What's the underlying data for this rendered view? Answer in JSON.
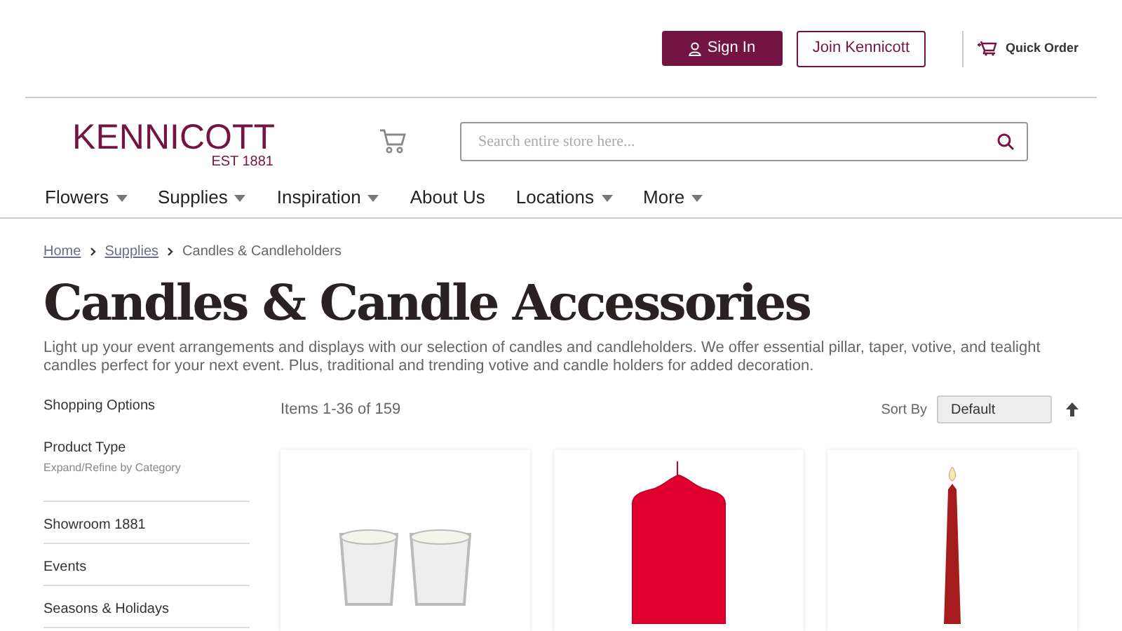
{
  "header": {
    "sign_in": "Sign In",
    "join": "Join Kennicott",
    "quick_order": "Quick Order"
  },
  "logo": {
    "name": "KENNICOTT",
    "tagline": "EST 1881"
  },
  "search": {
    "placeholder": "Search entire store here..."
  },
  "nav": [
    {
      "label": "Flowers",
      "dropdown": true
    },
    {
      "label": "Supplies",
      "dropdown": true
    },
    {
      "label": "Inspiration",
      "dropdown": true
    },
    {
      "label": "About Us",
      "dropdown": false
    },
    {
      "label": "Locations",
      "dropdown": true
    },
    {
      "label": "More",
      "dropdown": true
    }
  ],
  "breadcrumbs": [
    {
      "label": "Home",
      "link": true
    },
    {
      "label": "Supplies",
      "link": true
    },
    {
      "label": "Candles & Candleholders",
      "link": false
    }
  ],
  "title": "Candles & Candle Accessories",
  "description": "Light up your event arrangements and displays with our selection of candles and candleholders. We offer essential pillar, taper, votive, and tealight candles perfect for your next event. Plus, traditional and trending votive and candle holders for added decoration.",
  "sidebar": {
    "heading": "Shopping Options",
    "filter": {
      "title": "Product Type",
      "hint": "Expand/Refine by Category"
    },
    "items": [
      "Showroom 1881",
      "Events",
      "Seasons & Holidays"
    ]
  },
  "toolbar": {
    "count": "Items 1-36 of 159",
    "sort_label": "Sort By",
    "sort_value": "Default"
  },
  "products": [
    {
      "kind": "votive"
    },
    {
      "kind": "pillar"
    },
    {
      "kind": "taper"
    }
  ]
}
